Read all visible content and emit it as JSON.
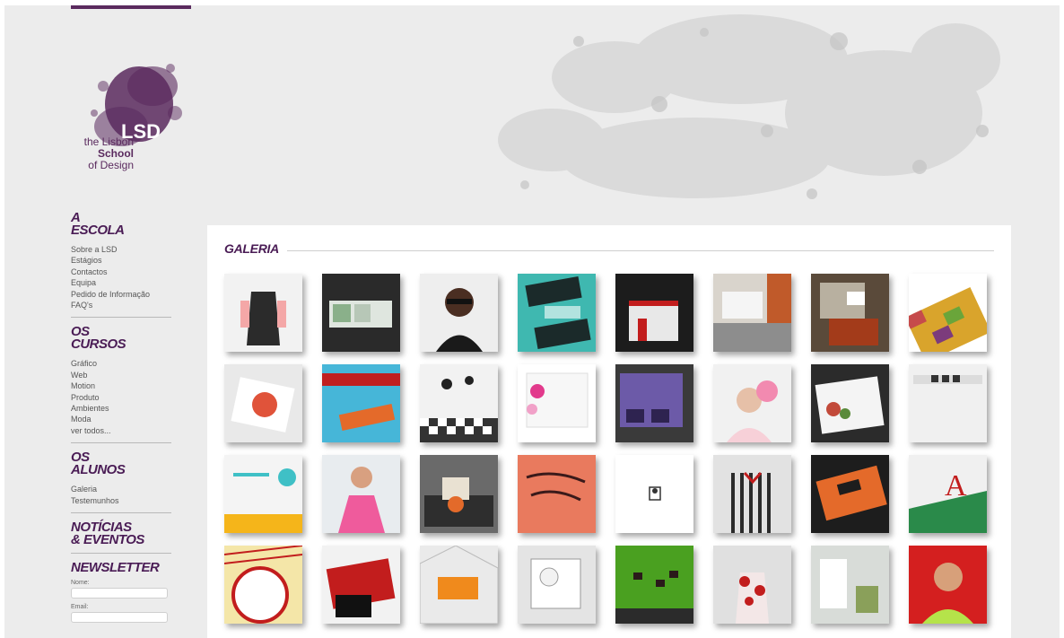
{
  "brand": {
    "logo_mark": "LSD",
    "logo_line1": "the Lisbon",
    "logo_line2": "School",
    "logo_line3": "of Design",
    "accent": "#4a1c55"
  },
  "sidebar": {
    "escola": {
      "title": "A\nESCOLA",
      "links": [
        "Sobre a LSD",
        "Estágios",
        "Contactos",
        "Equipa",
        "Pedido de Informação",
        "FAQ's"
      ]
    },
    "cursos": {
      "title": "OS\nCURSOS",
      "links": [
        "Gráfico",
        "Web",
        "Motion",
        "Produto",
        "Ambientes",
        "Moda",
        "ver todos..."
      ]
    },
    "alunos": {
      "title": "OS\nALUNOS",
      "links": [
        "Galeria",
        "Testemunhos"
      ]
    },
    "noticias": {
      "title": "NOTÍCIAS\n& EVENTOS"
    },
    "newsletter": {
      "title": "NEWSLETTER",
      "name_label": "Nome:",
      "email_label": "Email:"
    }
  },
  "gallery": {
    "title": "GALERIA",
    "thumbnails": [
      [
        "dress-on-mannequin",
        "website-dark-layout",
        "woman-with-glasses",
        "shake-posters",
        "exhibition-stand-red",
        "kitchen-interior",
        "room-3d-render",
        "pattern-booklet"
      ],
      [
        "food-box-packaging",
        "polaroid-australia-book",
        "checkered-event-space",
        "floral-web-layout",
        "purple-furniture",
        "woman-flower-headpiece",
        "sushi-box-packaging",
        "website-grey-layout"
      ],
      [
        "yellow-web-layout",
        "girl-pink-jacket",
        "office-3d-render",
        "brand-book-cover",
        "logo-illustration",
        "striped-top-fashion",
        "tiger-stripe-cards",
        "letter-a-notebook"
      ],
      [
        "crempsa-packaging",
        "gelpeixe-red-box",
        "orange-sofa-render",
        "white-plan-model",
        "grass-signs",
        "floral-dress",
        "store-interior-render",
        "woman-red-background"
      ]
    ]
  }
}
